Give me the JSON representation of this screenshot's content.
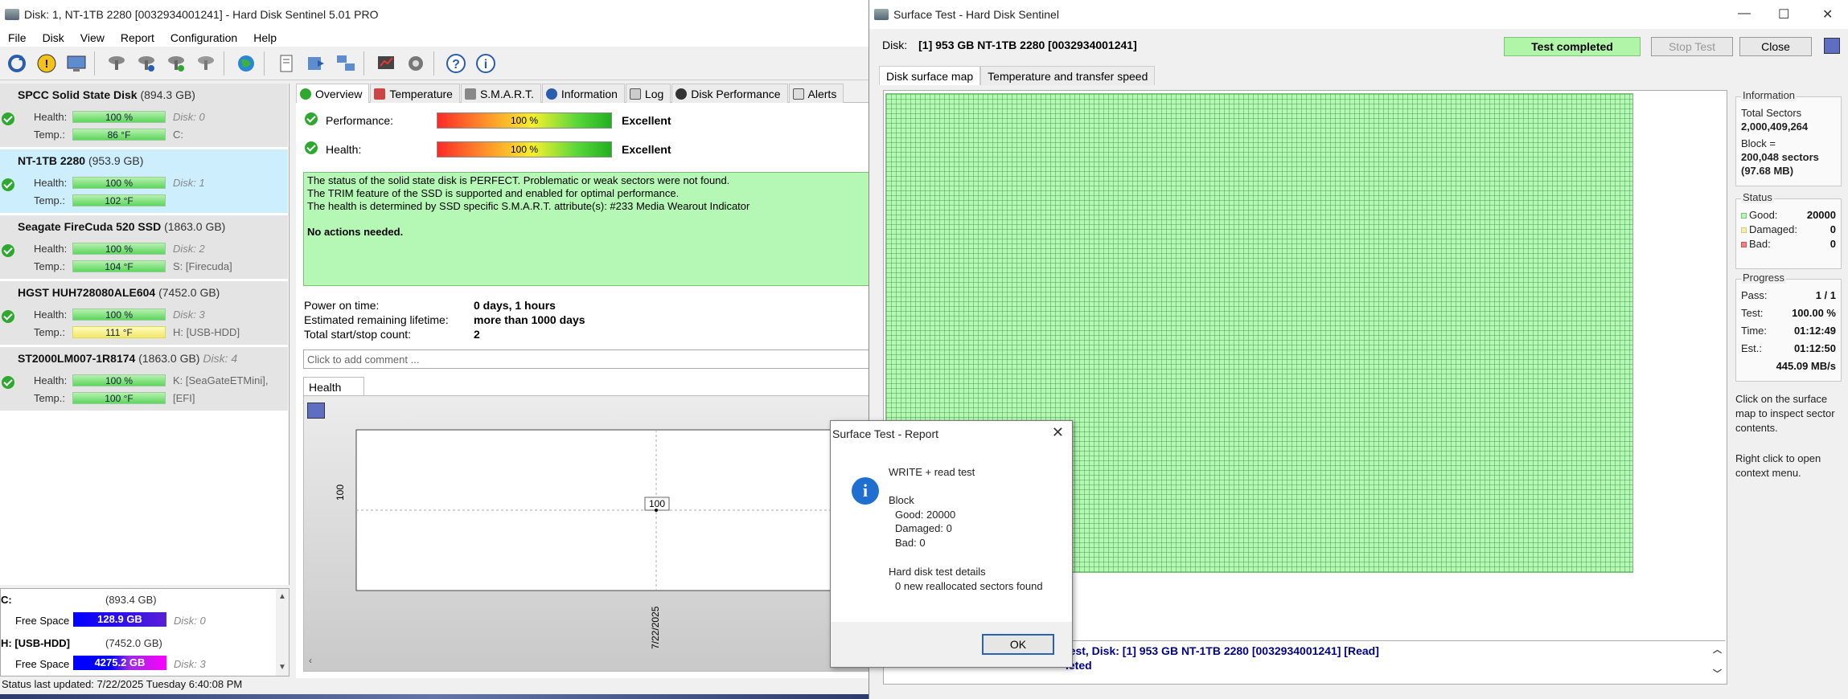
{
  "main": {
    "title": "Disk: 1, NT-1TB 2280 [0032934001241]  -  Hard Disk Sentinel 5.01 PRO",
    "menu": [
      "File",
      "Disk",
      "View",
      "Report",
      "Configuration",
      "Help"
    ],
    "disks": [
      {
        "name": "SPCC Solid State Disk",
        "size": "(894.3 GB)",
        "health": "100 %",
        "disk_no": "Disk: 0",
        "temp": "86 °F",
        "drive": "C:"
      },
      {
        "name": "NT-1TB 2280",
        "size": "(953.9 GB)",
        "health": "100 %",
        "disk_no": "Disk: 1",
        "temp": "102 °F",
        "drive": ""
      },
      {
        "name": "Seagate FireCuda 520 SSD",
        "size": "(1863.0 GB)",
        "health": "100 %",
        "disk_no": "Disk: 2",
        "temp": "104 °F",
        "drive": "S: [Firecuda]"
      },
      {
        "name": "HGST HUH728080ALE604",
        "size": "(7452.0 GB)",
        "health": "100 %",
        "disk_no": "Disk: 3",
        "temp": "111 °F",
        "drive": "H: [USB-HDD]"
      },
      {
        "name": "ST2000LM007-1R8174",
        "size": "(1863.0 GB)",
        "health": "100 %",
        "disk_no": "Disk: 4",
        "temp": "100 °F",
        "drive": "K: [SeaGateETMini],",
        "drive2": "[EFI]"
      }
    ],
    "labels": {
      "health": "Health:",
      "temp": "Temp.:",
      "free_space": "Free Space"
    },
    "drives": [
      {
        "letter": "C:",
        "size": "(893.4 GB)",
        "free": "128.9 GB",
        "disk": "Disk: 0"
      },
      {
        "letter": "H: [USB-HDD]",
        "size": "(7452.0 GB)",
        "free": "4275.2 GB",
        "disk": "Disk: 3"
      }
    ],
    "status": "Status last updated: 7/22/2025 Tuesday 6:40:08 PM",
    "tabs": [
      "Overview",
      "Temperature",
      "S.M.A.R.T.",
      "Information",
      "Log",
      "Disk Performance",
      "Alerts"
    ],
    "performance_label": "Performance:",
    "performance_value": "100 %",
    "performance_text": "Excellent",
    "health_label": "Health:",
    "health_value": "100 %",
    "health_text": "Excellent",
    "message": [
      "The status of the solid state disk is PERFECT. Problematic or weak sectors were not found.",
      "The TRIM feature of the SSD is supported and enabled for optimal performance.",
      "The health is determined by SSD specific S.M.A.R.T. attribute(s):  #233 Media Wearout Indicator",
      "No actions needed."
    ],
    "power_on_label": "Power on time:",
    "power_on_value": "0 days, 1 hours",
    "remaining_label": "Estimated remaining lifetime:",
    "remaining_value": "more than 1000 days",
    "startstop_label": "Total start/stop count:",
    "startstop_value": "2",
    "comment_placeholder": "Click to add comment ...",
    "health_tab": "Health (%)",
    "chart_y_label": "100",
    "chart_point_label": "100",
    "chart_x_label": "7/22/2025"
  },
  "surface": {
    "title": "Surface Test - Hard Disk Sentinel",
    "disk_label": "Disk:",
    "disk_value": "[1] 953 GB  NT-1TB 2280 [0032934001241]",
    "status_badge": "Test completed",
    "stop_btn": "Stop Test",
    "close_btn": "Close",
    "tabs": [
      "Disk surface map",
      "Temperature and transfer speed"
    ],
    "log_line1": "test, Disk: [1] 953 GB  NT-1TB 2280 [0032934001241] [Read]",
    "log_line2": "leted",
    "info": {
      "group": "Information",
      "total_sectors_label": "Total Sectors",
      "total_sectors": "2,000,409,264",
      "block_label": "Block =",
      "block_sectors": "200,048 sectors",
      "block_mb": "(97.68 MB)"
    },
    "status": {
      "group": "Status",
      "good_label": "Good:",
      "good": "20000",
      "damaged_label": "Damaged:",
      "damaged": "0",
      "bad_label": "Bad:",
      "bad": "0"
    },
    "progress": {
      "group": "Progress",
      "pass_label": "Pass:",
      "pass": "1 / 1",
      "test_label": "Test:",
      "test": "100.00 %",
      "time_label": "Time:",
      "time": "01:12:49",
      "est_label": "Est.:",
      "est": "01:12:50",
      "speed": "445.09 MB/s"
    },
    "help1": "Click on the surface map to inspect sector contents.",
    "help2": "Right click to open context menu."
  },
  "dialog": {
    "title": "Surface Test - Report",
    "line1": "WRITE + read test",
    "block": "Block",
    "good": "Good: 20000",
    "damaged": "Damaged: 0",
    "bad": "Bad: 0",
    "details": "Hard disk test details",
    "realloc": "0 new reallocated sectors found",
    "ok": "OK"
  },
  "colors": {
    "good": "#b5f7b5",
    "accent": "#2b63b4",
    "ok_green": "#2fa82f"
  }
}
